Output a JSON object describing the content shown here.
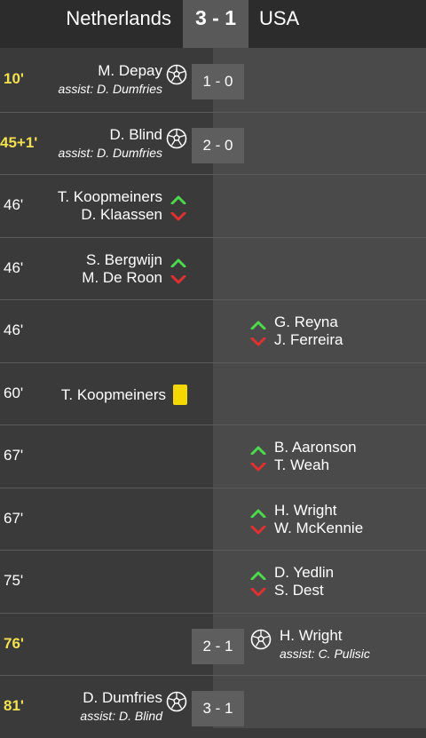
{
  "header": {
    "home_team": "Netherlands",
    "score": "3 - 1",
    "away_team": "USA"
  },
  "colors": {
    "goal_minute": "#f1e050",
    "sub_in": "#4cd94c",
    "sub_out": "#e03030",
    "yellow_card": "#f5d800"
  },
  "events": [
    {
      "minute": "10'",
      "type": "goal",
      "side": "home",
      "player": "M. Depay",
      "assist": "assist: D. Dumfries",
      "score": "1 - 0"
    },
    {
      "minute": "45+1'",
      "type": "goal",
      "side": "home",
      "player": "D. Blind",
      "assist": "assist: D. Dumfries",
      "score": "2 - 0"
    },
    {
      "minute": "46'",
      "type": "sub",
      "side": "home",
      "in": "T. Koopmeiners",
      "out": "D. Klaassen"
    },
    {
      "minute": "46'",
      "type": "sub",
      "side": "home",
      "in": "S. Bergwijn",
      "out": "M. De Roon"
    },
    {
      "minute": "46'",
      "type": "sub",
      "side": "away",
      "in": "G. Reyna",
      "out": "J. Ferreira"
    },
    {
      "minute": "60'",
      "type": "yellow-card",
      "side": "home",
      "player": "T. Koopmeiners"
    },
    {
      "minute": "67'",
      "type": "sub",
      "side": "away",
      "in": "B. Aaronson",
      "out": "T. Weah"
    },
    {
      "minute": "67'",
      "type": "sub",
      "side": "away",
      "in": "H. Wright",
      "out": "W. McKennie"
    },
    {
      "minute": "75'",
      "type": "sub",
      "side": "away",
      "in": "D. Yedlin",
      "out": "S. Dest"
    },
    {
      "minute": "76'",
      "type": "goal",
      "side": "away",
      "player": "H. Wright",
      "assist": "assist: C. Pulisic",
      "score": "2 - 1"
    },
    {
      "minute": "81'",
      "type": "goal",
      "side": "home",
      "player": "D. Dumfries",
      "assist": "assist: D. Blind",
      "score": "3 - 1"
    }
  ]
}
